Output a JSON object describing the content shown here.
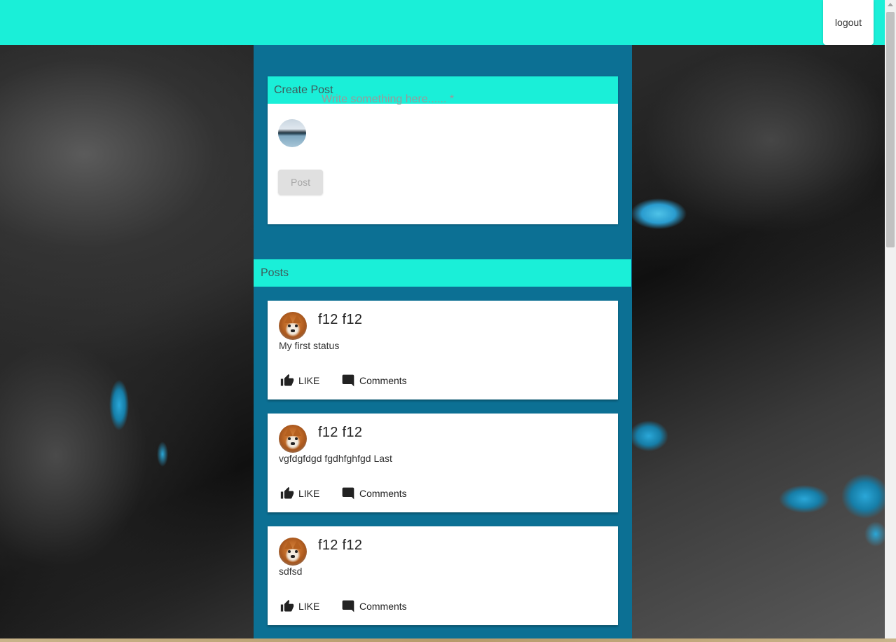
{
  "header": {
    "logout_label": "logout"
  },
  "create_post": {
    "title": "Create Post",
    "placeholder": "Write something here...... *",
    "post_label": "Post",
    "avatar_icon": "landscape-avatar-icon"
  },
  "posts_section": {
    "title": "Posts"
  },
  "posts": [
    {
      "author": "f12 f12",
      "text": "My first status",
      "like_label": "LIKE",
      "comments_label": "Comments"
    },
    {
      "author": "f12 f12",
      "text": "vgfdgfdgd fgdhfghfgd Last",
      "like_label": "LIKE",
      "comments_label": "Comments"
    },
    {
      "author": "f12 f12",
      "text": "sdfsd",
      "like_label": "LIKE",
      "comments_label": "Comments"
    }
  ],
  "colors": {
    "accent": "#1aefd8",
    "column": "#0c7094",
    "card": "#ffffff"
  },
  "icons": {
    "like": "thumb-up-icon",
    "comments": "comment-icon"
  }
}
